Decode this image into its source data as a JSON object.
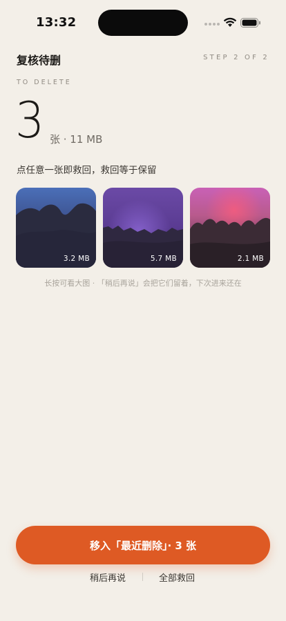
{
  "status": {
    "time": "13:32",
    "icons": [
      "signal-dots-icon",
      "wifi-icon",
      "battery-icon"
    ]
  },
  "header": {
    "title": "复核待删",
    "step": "STEP 2 OF 2"
  },
  "section_label": "TO DELETE",
  "summary": {
    "count": "3",
    "meta": "张 · 11 MB"
  },
  "hint": "点任意一张即救回，救回等于保留",
  "photos": [
    {
      "size": "3.2 MB"
    },
    {
      "size": "5.7 MB"
    },
    {
      "size": "2.1 MB"
    }
  ],
  "photo_tip": "长按可看大图 · 「稍后再说」会把它们留着，下次进来还在",
  "actions": {
    "primary": "移入「最近删除」· 3 张",
    "later": "稍后再说",
    "rescue_all": "全部救回"
  },
  "colors": {
    "background": "#f3efe8",
    "accent": "#de5a24"
  }
}
